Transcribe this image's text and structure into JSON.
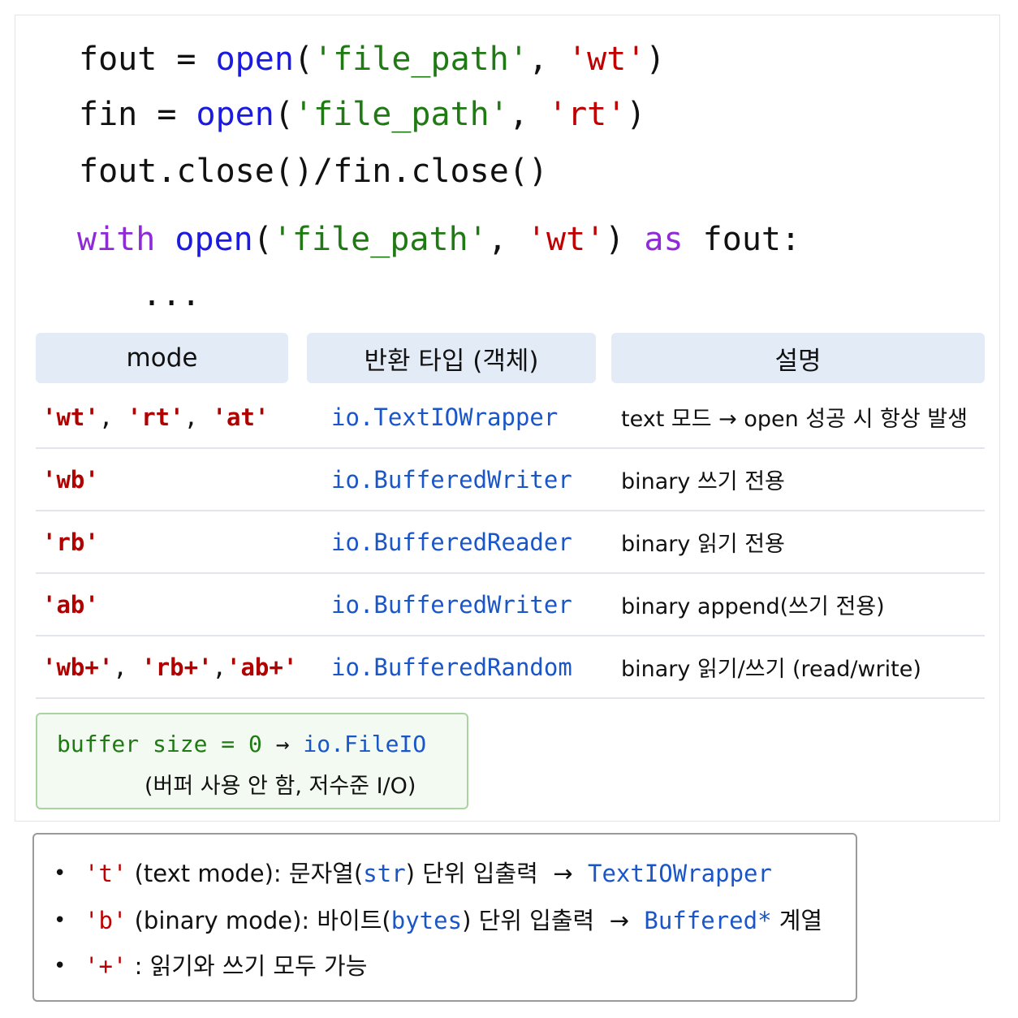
{
  "code": {
    "line1": {
      "var": "fout",
      "eq": " = ",
      "fn": "open",
      "p1": "(",
      "arg1": "'file_path'",
      "comma": ", ",
      "arg2": "'wt'",
      "p2": ")"
    },
    "line2": {
      "var": "fin",
      "eq": " = ",
      "fn": "open",
      "p1": "(",
      "arg1": "'file_path'",
      "comma": ", ",
      "arg2": "'rt'",
      "p2": ")"
    },
    "line3": "fout.close()/fin.close()",
    "line4": {
      "with": "with",
      "sp": " ",
      "fn": "open",
      "p1": "(",
      "arg1": "'file_path'",
      "comma": ", ",
      "arg2": "'wt'",
      "p2": ") ",
      "as": "as",
      "tail": " fout:"
    },
    "line5": "..."
  },
  "table": {
    "headers": [
      "mode",
      "반환 타입 (객체)",
      "설명"
    ],
    "rows": [
      {
        "modes": [
          "'wt'",
          "'rt'",
          "'at'"
        ],
        "seps": [
          ", ",
          ", "
        ],
        "type": "io.TextIOWrapper",
        "desc": "text 모드 → open 성공 시 항상 발생"
      },
      {
        "modes": [
          "'wb'"
        ],
        "type": "io.BufferedWriter",
        "desc": "binary 쓰기 전용"
      },
      {
        "modes": [
          "'rb'"
        ],
        "type": "io.BufferedReader",
        "desc": "binary 읽기 전용"
      },
      {
        "modes": [
          "'ab'"
        ],
        "type": "io.BufferedWriter",
        "desc": "binary append(쓰기 전용)"
      },
      {
        "modes": [
          "'wb+'",
          "'rb+'",
          "'ab+'"
        ],
        "seps": [
          ", ",
          ","
        ],
        "type": "io.BufferedRandom",
        "desc": "binary 읽기/쓰기 (read/write)"
      }
    ]
  },
  "buffer_note": {
    "left": "buffer size = 0 ",
    "arrow": "→",
    "right": " io.FileIO",
    "sub": "(버퍼 사용 안 함, 저수준 I/O)"
  },
  "notes": [
    {
      "bullet": "•",
      "mode": "'t'",
      "a": " (text mode): 문자열(",
      "b": "str",
      "c": ") 단위 입출력  →  ",
      "d": "TextIOWrapper",
      "e": ""
    },
    {
      "bullet": "•",
      "mode": "'b'",
      "a": " (binary mode): 바이트(",
      "b": "bytes",
      "c": ") 단위 입출력  →  ",
      "d": "Buffered*",
      "e": " 계열"
    },
    {
      "bullet": "•",
      "mode": "'+'",
      "a": " : 읽기와 쓰기 모두 가능",
      "b": "",
      "c": "",
      "d": "",
      "e": ""
    }
  ]
}
